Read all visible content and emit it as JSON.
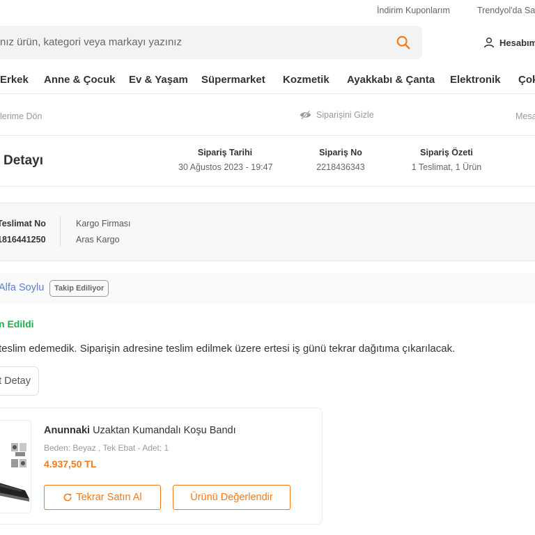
{
  "top_links": {
    "coupons": "İndirim Kuponlarım",
    "sell": "Trendyol'da Sa"
  },
  "search": {
    "placeholder": "nız ürün, kategori veya markayı yazınız",
    "icon": "search-icon",
    "icon_color": "#f27a1a"
  },
  "account": {
    "label": "Hesabım",
    "icon": "user-icon"
  },
  "nav": {
    "items": [
      "Erkek",
      "Anne & Çocuk",
      "Ev & Yaşam",
      "Süpermarket",
      "Kozmetik",
      "Ayakkabı & Çanta",
      "Elektronik",
      "Çok"
    ]
  },
  "subbar": {
    "back": "lerime Dön",
    "hide_order": "Siparişini Gizle",
    "hide_icon": "eye-off-icon",
    "messages": "Mesa"
  },
  "order": {
    "title": "Detayı",
    "date_label": "Sipariş Tarihi",
    "date_value": "30 Ağustos 2023 - 19:47",
    "number_label": "Sipariş No",
    "number_value": "2218436343",
    "summary_label": "Sipariş Özeti",
    "summary_value": "1 Teslimat, 1 Ürün"
  },
  "delivery": {
    "no_label": "Teslimat No",
    "no_value": "1816441250",
    "cargo_label": "Kargo Firması",
    "cargo_value": "Aras Kargo"
  },
  "receiver": {
    "name": "Alfa Soylu",
    "badge": "Takip Ediliyor"
  },
  "status": {
    "label": "n Edildi",
    "color": "#1fae4b",
    "message": "teslim edemedik. Siparişin adresine teslim edilmek üzere ertesi iş günü tekrar dağıtıma çıkarılacak."
  },
  "detail_button": {
    "label": "t Detay"
  },
  "product": {
    "brand": "Anunnaki",
    "name": "Uzaktan Kumandalı Koşu Bandı",
    "attributes": "Beden: Beyaz , Tek Ebat - Adet: 1",
    "price": "4.937,50 TL",
    "rebuy_label": "Tekrar Satın Al",
    "rebuy_icon": "refresh-icon",
    "review_label": "Ürünü Değerlendir",
    "accent_color": "#f27a1a"
  }
}
